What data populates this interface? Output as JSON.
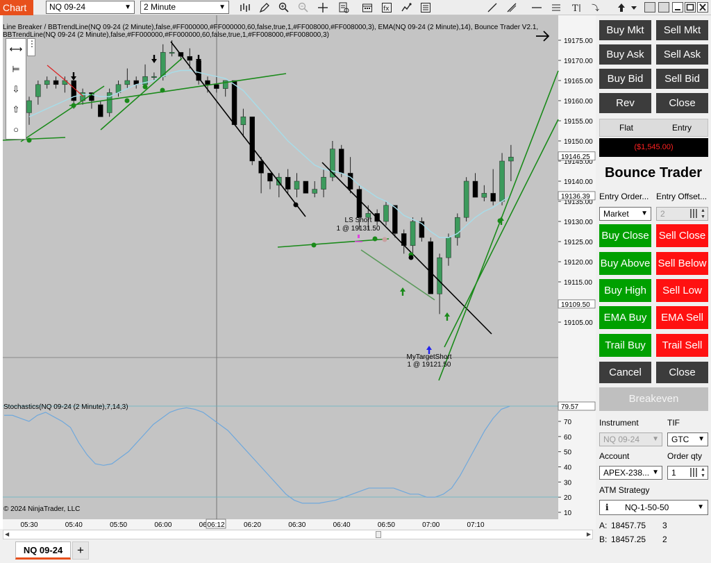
{
  "toolbar": {
    "chart_tab": "Chart",
    "instrument": "NQ 09-24",
    "interval": "2 Minute"
  },
  "chart": {
    "header_line1": "Line Breaker / BBTrendLine(NQ 09-24 (2 Minute),false,#FF000000,#FF000000,60,false,true,1,#FF008000,#FF008000,3), EMA(NQ 09-24 (2 Minute),14), Bounce Trader V2.1,",
    "header_line2": "BBTrendLine(NQ 09-24 (2 Minute),false,#FF000000,#FF000000,60,false,true,1,#FF008000,#FF008000,3)",
    "stoch_label": "Stochastics(NQ 09-24 (2 Minute),7,14,3)",
    "copyright": "© 2024 NinjaTrader, LLC",
    "price_labels": [
      "19175.00",
      "19170.00",
      "19165.00",
      "19160.00",
      "19155.00",
      "19150.00",
      "19145.00",
      "19140.00",
      "19135.00",
      "19130.00",
      "19125.00",
      "19120.00",
      "19115.00",
      "19110.00",
      "19105.00"
    ],
    "price_flags": [
      "19146.25",
      "19136.39",
      "19109.50"
    ],
    "stoch_labels": [
      "70",
      "60",
      "50",
      "40",
      "30",
      "20",
      "10"
    ],
    "stoch_flag": "79.57",
    "time_labels": [
      "05:30",
      "05:40",
      "05:50",
      "06:00",
      "06:10",
      "06:20",
      "06:30",
      "06:40",
      "06:50",
      "07:00",
      "07:10"
    ],
    "crosshair_time": "06:12",
    "annotations": {
      "ls_short": "LS Short",
      "ls_short_qty": "1 @ 19131.50",
      "target": "MyTargetShort",
      "target_qty": "1 @ 19121.50"
    },
    "colors": {
      "up": "#3c9a5c",
      "down": "#000000",
      "ema": "#a8dce8",
      "trend": "#1a8a1a",
      "stoch": "#6fa8dc"
    }
  },
  "bottom_tabs": {
    "active": "NQ 09-24",
    "add": "+"
  },
  "panel": {
    "buy_mkt": "Buy Mkt",
    "sell_mkt": "Sell Mkt",
    "buy_ask": "Buy Ask",
    "sell_ask": "Sell Ask",
    "buy_bid": "Buy Bid",
    "sell_bid": "Sell Bid",
    "rev": "Rev",
    "close": "Close",
    "flat": "Flat",
    "entry": "Entry",
    "pnl": "($1,545.00)",
    "title": "Bounce Trader",
    "entry_order_label": "Entry Order...",
    "entry_offset_label": "Entry Offset...",
    "entry_order_value": "Market",
    "entry_offset_value": "2",
    "buy_close": "Buy Close",
    "sell_close": "Sell Close",
    "buy_above": "Buy Above",
    "sell_below": "Sell Below",
    "buy_high": "Buy High",
    "sell_low": "Sell Low",
    "ema_buy": "EMA Buy",
    "ema_sell": "EMA Sell",
    "trail_buy": "Trail Buy",
    "trail_sell": "Trail Sell",
    "cancel": "Cancel",
    "close2": "Close",
    "breakeven": "Breakeven",
    "instrument_label": "Instrument",
    "tif_label": "TIF",
    "instrument_value": "NQ 09-24",
    "tif_value": "GTC",
    "account_label": "Account",
    "order_qty_label": "Order qty",
    "account_value": "APEX-238...",
    "order_qty_value": "1",
    "atm_label": "ATM Strategy",
    "atm_value": "NQ-1-50-50",
    "ask_label": "A:",
    "ask_price": "18457.75",
    "ask_size": "3",
    "bid_label": "B:",
    "bid_price": "18457.25",
    "bid_size": "2"
  }
}
